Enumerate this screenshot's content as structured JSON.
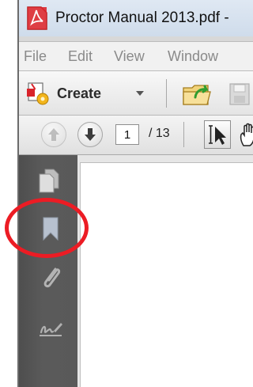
{
  "window": {
    "title": "Proctor Manual 2013.pdf -"
  },
  "menubar": {
    "items": [
      "File",
      "Edit",
      "View",
      "Window"
    ]
  },
  "toolbar": {
    "create_label": "Create"
  },
  "navigation": {
    "current_page": "1",
    "page_total": "/ 13"
  },
  "left_panel": {
    "icons": [
      "pages-icon",
      "bookmark-icon",
      "attachment-icon",
      "signature-icon"
    ],
    "highlighted": "bookmark-icon"
  },
  "colors": {
    "highlight_ring": "#ec1c24",
    "nav_pane": "#575757"
  }
}
